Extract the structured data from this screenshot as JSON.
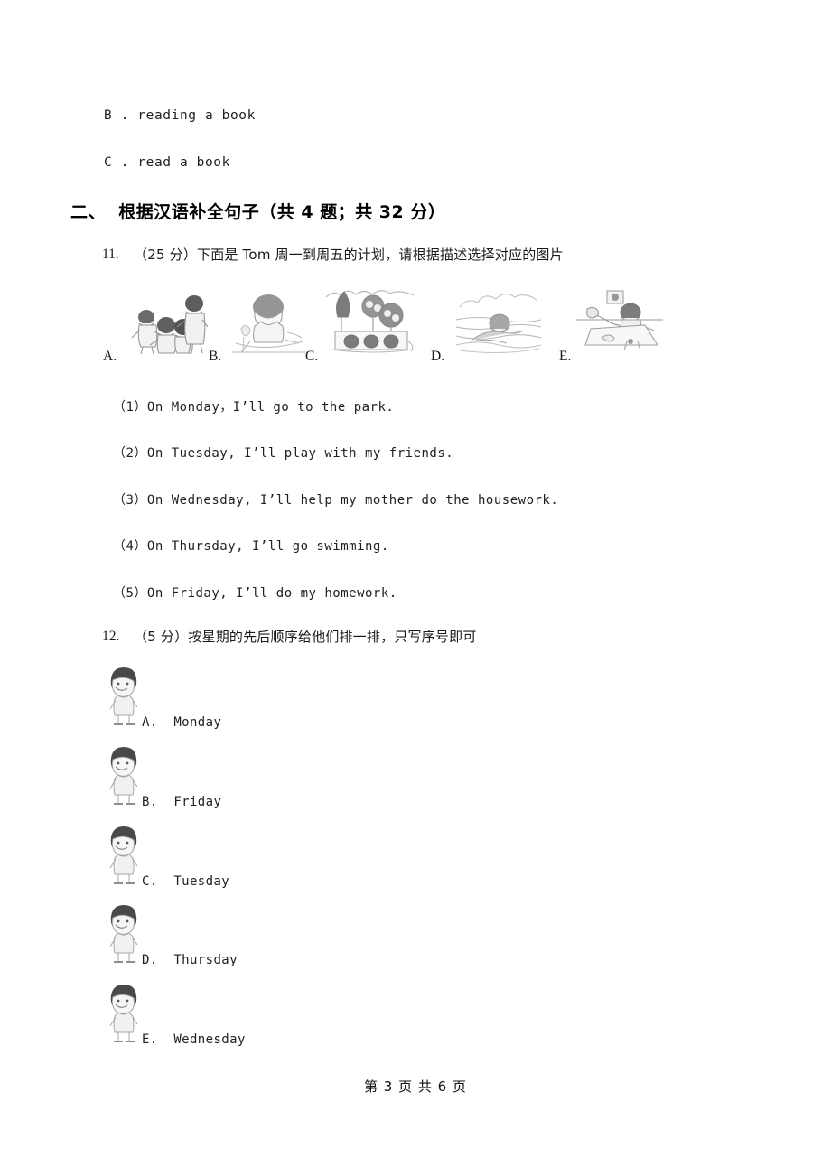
{
  "document": {
    "page_footer": "第 3 页 共 6 页"
  },
  "carryover_options": [
    {
      "text": "B . reading a book"
    },
    {
      "text": "C . read a book"
    }
  ],
  "section": {
    "heading": "二、  根据汉语补全句子（共 4 题；共 32 分）"
  },
  "questions": [
    {
      "number": "11.",
      "prompt": "（25 分）下面是 Tom 周一到周五的计划，请根据描述选择对应的图片",
      "picture_options": [
        {
          "letter": "A.",
          "icon": "children-playing-group-icon"
        },
        {
          "letter": "B.",
          "icon": "child-doing-homework-at-desk-icon"
        },
        {
          "letter": "C.",
          "icon": "park-with-trees-and-flowers-icon"
        },
        {
          "letter": "D.",
          "icon": "child-swimming-in-water-icon"
        },
        {
          "letter": "E.",
          "icon": "child-doing-housework-icon"
        }
      ],
      "sub_questions": [
        {
          "text": "（1）On Monday，I’ll go to the park."
        },
        {
          "text": "（2）On Tuesday, I’ll play with my friends."
        },
        {
          "text": "（3）On Wednesday, I’ll help my mother do the housework."
        },
        {
          "text": "（4）On Thursday, I’ll go swimming."
        },
        {
          "text": "（5）On Friday, I’ll do my homework."
        }
      ]
    },
    {
      "number": "12.",
      "prompt": "（5 分）按星期的先后顺序给他们排一排，只写序号即可",
      "items": [
        {
          "label": "A.  Monday",
          "icon": "cartoon-child-standing-icon"
        },
        {
          "label": "B.  Friday",
          "icon": "cartoon-child-standing-icon"
        },
        {
          "label": "C.  Tuesday",
          "icon": "cartoon-child-standing-icon"
        },
        {
          "label": "D.  Thursday",
          "icon": "cartoon-child-standing-icon"
        },
        {
          "label": "E.  Wednesday",
          "icon": "cartoon-child-standing-icon"
        }
      ]
    }
  ]
}
